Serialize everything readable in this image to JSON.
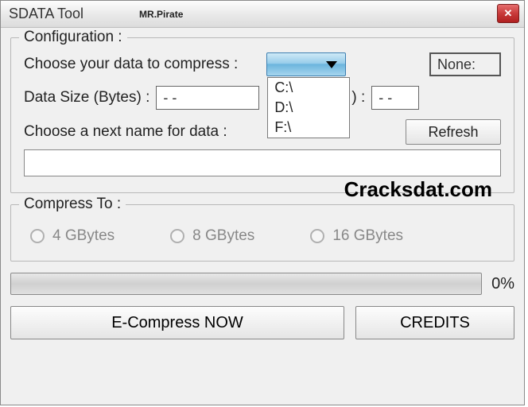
{
  "window": {
    "title": "SDATA Tool",
    "subtitle": "MR.Pirate"
  },
  "config": {
    "group_title": "Configuration :",
    "choose_label": "Choose your data to compress :",
    "none_label": "None:",
    "size_label": "Data Size (Bytes) :",
    "size_value": "- -",
    "size_paren_close": ") :",
    "size_value2": "- -",
    "name_label": "Choose a next name for data :",
    "refresh_label": "Refresh",
    "name_value": "",
    "drives": [
      "C:\\",
      "D:\\",
      "F:\\"
    ]
  },
  "compress": {
    "group_title": "Compress To :",
    "options": [
      "4 GBytes",
      "8 GBytes",
      "16 GBytes"
    ]
  },
  "progress": {
    "percent": "0%"
  },
  "buttons": {
    "ecompress": "E-Compress NOW",
    "credits": "CREDITS"
  },
  "watermark": "Cracksdat.com"
}
